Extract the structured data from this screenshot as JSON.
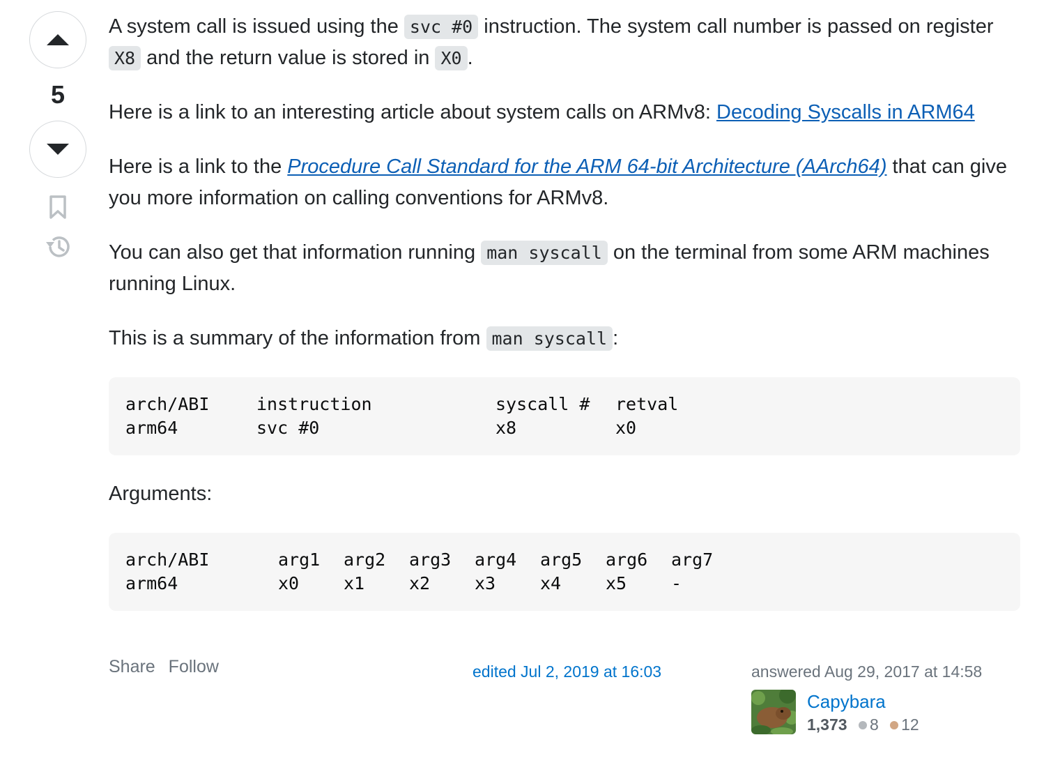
{
  "vote": {
    "count": "5"
  },
  "icons": {
    "upvote": "arrow-up-icon",
    "downvote": "arrow-down-icon",
    "bookmark": "bookmark-icon",
    "history": "history-icon"
  },
  "answer": {
    "p1": {
      "t1": "A system call is issued using the ",
      "c1": "svc #0",
      "t2": " instruction. The system call number is passed on register ",
      "c2": "X8",
      "t3": " and the return value is stored in ",
      "c3": "X0",
      "t4": "."
    },
    "p2": {
      "t1": "Here is a link to an interesting article about system calls on ARMv8: ",
      "link": "Decoding Syscalls in ARM64"
    },
    "p3": {
      "t1": "Here is a link to the ",
      "link": "Procedure Call Standard for the ARM 64-bit Architecture (AArch64)",
      "t2": " that can give you more information on calling conventions for ARMv8."
    },
    "p4": {
      "t1": "You can also get that information running ",
      "c1": "man syscall",
      "t2": " on the terminal from some ARM machines running Linux."
    },
    "p5": {
      "t1": "This is a summary of the information from ",
      "c1": "man syscall",
      "t2": ":"
    },
    "table1": {
      "headers": [
        "arch/ABI",
        "instruction",
        "syscall #",
        "retval"
      ],
      "row": [
        "arm64",
        "svc #0",
        "x8",
        "x0"
      ]
    },
    "arguments_label": "Arguments:",
    "table2": {
      "headers": [
        "arch/ABI",
        "arg1",
        "arg2",
        "arg3",
        "arg4",
        "arg5",
        "arg6",
        "arg7"
      ],
      "row": [
        "arm64",
        "x0",
        "x1",
        "x2",
        "x3",
        "x4",
        "x5",
        "-"
      ]
    }
  },
  "menu": {
    "share": "Share",
    "follow": "Follow"
  },
  "edited": "edited Jul 2, 2019 at 16:03",
  "user": {
    "answered": "answered Aug 29, 2017 at 14:58",
    "name": "Capybara",
    "reputation": "1,373",
    "silver": "8",
    "bronze": "12",
    "silver_color": "#b4b8bc",
    "bronze_color": "#d1a684"
  }
}
